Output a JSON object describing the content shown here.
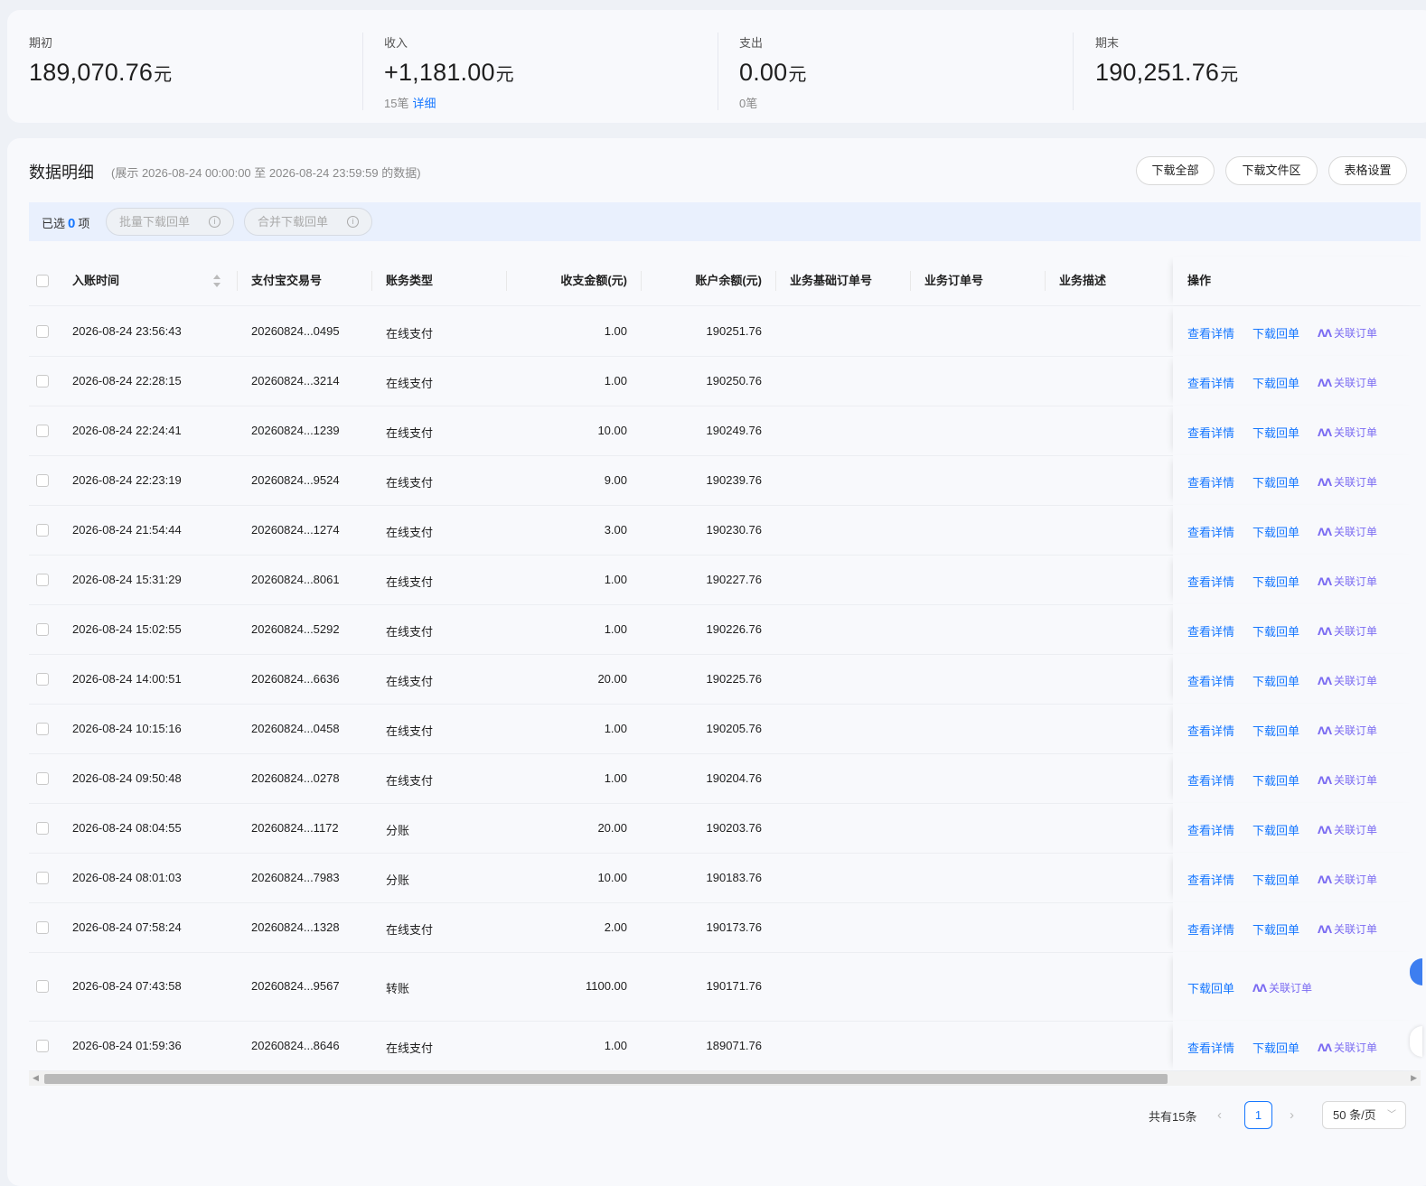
{
  "summary": {
    "opening": {
      "label": "期初",
      "value": "189,070.76",
      "unit": "元"
    },
    "income": {
      "label": "收入",
      "value": "+1,181.00",
      "unit": "元",
      "count": "15笔",
      "detail_link": "详细"
    },
    "expense": {
      "label": "支出",
      "value": "0.00",
      "unit": "元",
      "count": "0笔"
    },
    "closing": {
      "label": "期末",
      "value": "190,251.76",
      "unit": "元"
    }
  },
  "detail": {
    "title": "数据明细",
    "range": "(展示 2026-08-24 00:00:00 至 2026-08-24 23:59:59 的数据)",
    "buttons": {
      "download_all": "下载全部",
      "download_files": "下载文件区",
      "table_settings": "表格设置"
    }
  },
  "selection": {
    "prefix": "已选",
    "count": "0",
    "suffix": "项",
    "batch_download": "批量下载回单",
    "merge_download": "合并下载回单",
    "info_glyph": "i"
  },
  "table": {
    "columns": {
      "time": "入账时间",
      "trade_no": "支付宝交易号",
      "type": "账务类型",
      "amount": "收支金额(元)",
      "balance": "账户余额(元)",
      "base_order": "业务基础订单号",
      "order": "业务订单号",
      "desc": "业务描述",
      "actions": "操作"
    },
    "action_labels": {
      "view": "查看详情",
      "download": "下载回单",
      "related": "关联订单",
      "ai_glyph": "ᐱᐱ"
    },
    "rows": [
      {
        "time": "2026-08-24 23:56:43",
        "trade_no": "20260824...0495",
        "type": "在线支付",
        "amount": "1.00",
        "balance": "190251.76",
        "has_view": true
      },
      {
        "time": "2026-08-24 22:28:15",
        "trade_no": "20260824...3214",
        "type": "在线支付",
        "amount": "1.00",
        "balance": "190250.76",
        "has_view": true
      },
      {
        "time": "2026-08-24 22:24:41",
        "trade_no": "20260824...1239",
        "type": "在线支付",
        "amount": "10.00",
        "balance": "190249.76",
        "has_view": true
      },
      {
        "time": "2026-08-24 22:23:19",
        "trade_no": "20260824...9524",
        "type": "在线支付",
        "amount": "9.00",
        "balance": "190239.76",
        "has_view": true
      },
      {
        "time": "2026-08-24 21:54:44",
        "trade_no": "20260824...1274",
        "type": "在线支付",
        "amount": "3.00",
        "balance": "190230.76",
        "has_view": true
      },
      {
        "time": "2026-08-24 15:31:29",
        "trade_no": "20260824...8061",
        "type": "在线支付",
        "amount": "1.00",
        "balance": "190227.76",
        "has_view": true
      },
      {
        "time": "2026-08-24 15:02:55",
        "trade_no": "20260824...5292",
        "type": "在线支付",
        "amount": "1.00",
        "balance": "190226.76",
        "has_view": true
      },
      {
        "time": "2026-08-24 14:00:51",
        "trade_no": "20260824...6636",
        "type": "在线支付",
        "amount": "20.00",
        "balance": "190225.76",
        "has_view": true
      },
      {
        "time": "2026-08-24 10:15:16",
        "trade_no": "20260824...0458",
        "type": "在线支付",
        "amount": "1.00",
        "balance": "190205.76",
        "has_view": true
      },
      {
        "time": "2026-08-24 09:50:48",
        "trade_no": "20260824...0278",
        "type": "在线支付",
        "amount": "1.00",
        "balance": "190204.76",
        "has_view": true
      },
      {
        "time": "2026-08-24 08:04:55",
        "trade_no": "20260824...1172",
        "type": "分账",
        "amount": "20.00",
        "balance": "190203.76",
        "has_view": true
      },
      {
        "time": "2026-08-24 08:01:03",
        "trade_no": "20260824...7983",
        "type": "分账",
        "amount": "10.00",
        "balance": "190183.76",
        "has_view": true
      },
      {
        "time": "2026-08-24 07:58:24",
        "trade_no": "20260824...1328",
        "type": "在线支付",
        "amount": "2.00",
        "balance": "190173.76",
        "has_view": true
      },
      {
        "time": "2026-08-24 07:43:58",
        "trade_no": "20260824...9567",
        "type": "转账",
        "amount": "1100.00",
        "balance": "190171.76",
        "has_view": false
      },
      {
        "time": "2026-08-24 01:59:36",
        "trade_no": "20260824...8646",
        "type": "在线支付",
        "amount": "1.00",
        "balance": "189071.76",
        "has_view": true
      }
    ]
  },
  "pagination": {
    "total": "共有15条",
    "prev": "‹",
    "current_page": "1",
    "next": "›",
    "page_size": "50 条/页",
    "chevron": "﹀"
  },
  "scrollbar": {
    "left_arrow": "◀",
    "right_arrow": "▶"
  },
  "colors": {
    "link": "#1677ff",
    "ai_link": "#7b6cf2",
    "selection_bar": "#e9f0fd"
  }
}
